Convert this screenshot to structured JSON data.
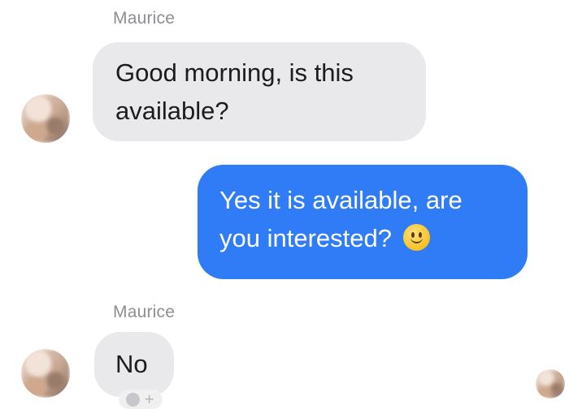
{
  "messages": [
    {
      "sender": "Maurice",
      "direction": "incoming",
      "text": "Good morning, is this\navailable?"
    },
    {
      "direction": "outgoing",
      "text": "Yes it is available, are\nyou interested?",
      "emoji": "slightly-smiling-face"
    },
    {
      "sender": "Maurice",
      "direction": "incoming",
      "text": "No"
    }
  ],
  "colors": {
    "incoming_bubble": "#e9e9eb",
    "outgoing_bubble": "#2f7cf6",
    "sender_name": "#8e8e93"
  }
}
